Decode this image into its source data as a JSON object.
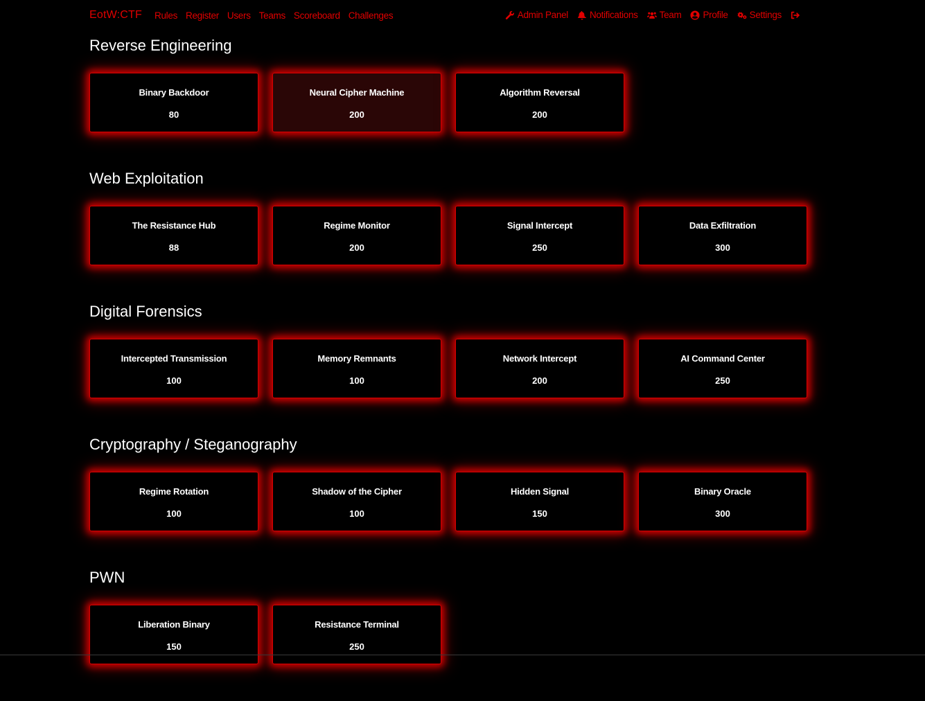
{
  "navbar": {
    "brand": "EotW:CTF",
    "left_links": [
      "Rules",
      "Register",
      "Users",
      "Teams",
      "Scoreboard",
      "Challenges"
    ],
    "right_links": [
      {
        "label": "Admin Panel",
        "icon": "wrench-icon"
      },
      {
        "label": "Notifications",
        "icon": "bell-icon"
      },
      {
        "label": "Team",
        "icon": "users-icon"
      },
      {
        "label": "Profile",
        "icon": "user-circle-icon"
      },
      {
        "label": "Settings",
        "icon": "cogs-icon"
      },
      {
        "label": "",
        "icon": "sign-out-icon"
      }
    ]
  },
  "theme": {
    "accent": "#e00000",
    "background": "#000000",
    "text": "#ffffff",
    "hover_card_background": "#2a0606"
  },
  "categories": [
    {
      "title": "Reverse Engineering",
      "challenges": [
        {
          "name": "Binary Backdoor",
          "points": "80"
        },
        {
          "name": "Neural Cipher Machine",
          "points": "200",
          "hovered": true
        },
        {
          "name": "Algorithm Reversal",
          "points": "200"
        }
      ]
    },
    {
      "title": "Web Exploitation",
      "challenges": [
        {
          "name": "The Resistance Hub",
          "points": "88"
        },
        {
          "name": "Regime Monitor",
          "points": "200"
        },
        {
          "name": "Signal Intercept",
          "points": "250"
        },
        {
          "name": "Data Exfiltration",
          "points": "300"
        }
      ]
    },
    {
      "title": "Digital Forensics",
      "challenges": [
        {
          "name": "Intercepted Transmission",
          "points": "100"
        },
        {
          "name": "Memory Remnants",
          "points": "100"
        },
        {
          "name": "Network Intercept",
          "points": "200"
        },
        {
          "name": "AI Command Center",
          "points": "250"
        }
      ]
    },
    {
      "title": "Cryptography / Steganography",
      "challenges": [
        {
          "name": "Regime Rotation",
          "points": "100"
        },
        {
          "name": "Shadow of the Cipher",
          "points": "100"
        },
        {
          "name": "Hidden Signal",
          "points": "150"
        },
        {
          "name": "Binary Oracle",
          "points": "300"
        }
      ]
    },
    {
      "title": "PWN",
      "challenges": [
        {
          "name": "Liberation Binary",
          "points": "150"
        },
        {
          "name": "Resistance Terminal",
          "points": "250"
        }
      ]
    }
  ]
}
